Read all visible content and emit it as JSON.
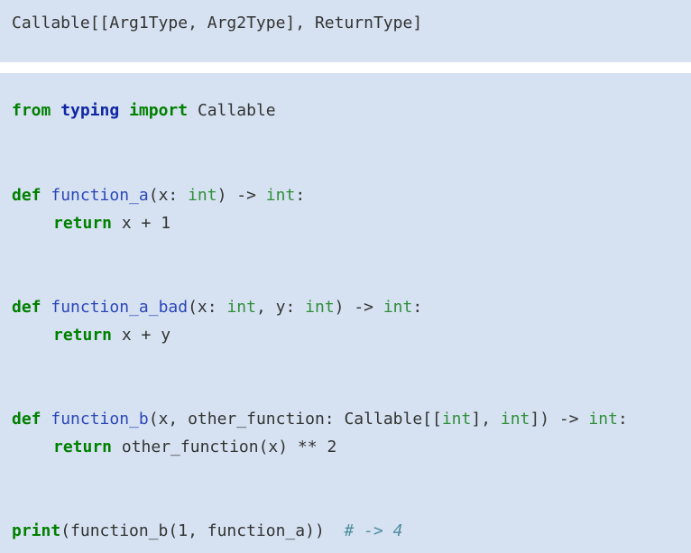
{
  "signature_block": {
    "text": "Callable[[Arg1Type, Arg2Type], ReturnType]"
  },
  "code": {
    "line1": {
      "from": "from",
      "module": "typing",
      "import": "import",
      "name": "Callable"
    },
    "line2": {
      "def": "def",
      "fname": "function_a",
      "p1": "(x: ",
      "t1": "int",
      "p2": ") -> ",
      "t2": "int",
      "p3": ":"
    },
    "line3": {
      "ret": "return",
      "expr": " x + 1"
    },
    "line4": {
      "def": "def",
      "fname": "function_a_bad",
      "p1": "(x: ",
      "t1": "int",
      "p2": ", y: ",
      "t2": "int",
      "p3": ") -> ",
      "t3": "int",
      "p4": ":"
    },
    "line5": {
      "ret": "return",
      "expr": " x + y"
    },
    "line6": {
      "def": "def",
      "fname": "function_b",
      "p1": "(x, other_function: Callable[[",
      "t1": "int",
      "p2": "], ",
      "t2": "int",
      "p3": "]) -> ",
      "t3": "int",
      "p4": ":"
    },
    "line7": {
      "ret": "return",
      "expr": " other_function(x) ** 2"
    },
    "line8": {
      "print": "print",
      "args": "(function_b(1, function_a))",
      "gap": "  ",
      "comment": "# -> 4"
    }
  }
}
